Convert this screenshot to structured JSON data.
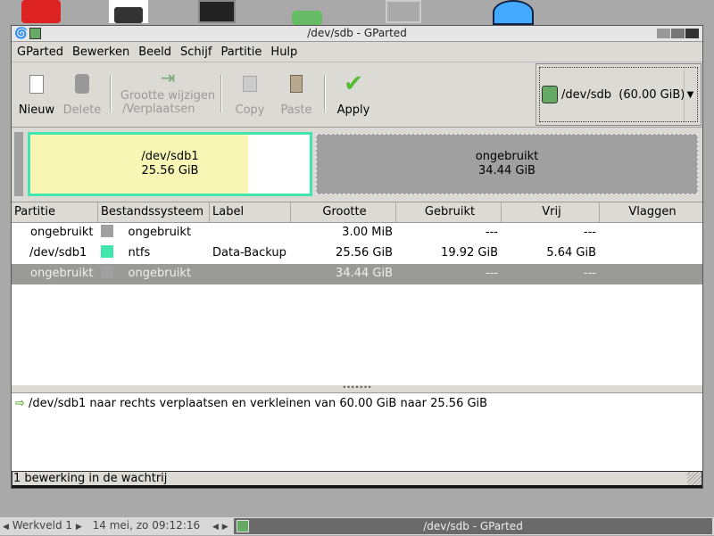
{
  "window": {
    "title": "/dev/sdb - GParted"
  },
  "menu": [
    "GParted",
    "Bewerken",
    "Beeld",
    "Schijf",
    "Partitie",
    "Hulp"
  ],
  "toolbar": {
    "new": "Nieuw",
    "delete": "Delete",
    "resize1": "Grootte wijzigen",
    "resize2": "/Verplaatsen",
    "copy": "Copy",
    "paste": "Paste",
    "apply": "Apply"
  },
  "device": {
    "name": "/dev/sdb",
    "size": "(60.00 GiB)"
  },
  "map": {
    "p1": {
      "name": "/dev/sdb1",
      "size": "25.56 GiB",
      "used_fraction": 0.78
    },
    "p2": {
      "name": "ongebruikt",
      "size": "34.44 GiB"
    }
  },
  "table": {
    "headers": [
      "Partitie",
      "Bestandssysteem",
      "Label",
      "Grootte",
      "Gebruikt",
      "Vrij",
      "Vlaggen"
    ],
    "rows": [
      {
        "partition": "ongebruikt",
        "fs": "ongebruikt",
        "color": "#a0a0a0",
        "label": "",
        "size": "3.00 MiB",
        "used": "---",
        "free": "---",
        "flags": ""
      },
      {
        "partition": "/dev/sdb1",
        "fs": "ntfs",
        "color": "#42e5ac",
        "label": "Data-Backup",
        "size": "25.56 GiB",
        "used": "19.92 GiB",
        "free": "5.64 GiB",
        "flags": ""
      },
      {
        "partition": "ongebruikt",
        "fs": "ongebruikt",
        "color": "#a0a0a0",
        "label": "",
        "size": "34.44 GiB",
        "used": "---",
        "free": "---",
        "flags": ""
      }
    ]
  },
  "log": {
    "op": "/dev/sdb1 naar rechts verplaatsen en verkleinen van 60.00 GiB naar 25.56 GiB"
  },
  "status": "1 bewerking in de wachtrij",
  "taskbar": {
    "workspace": "Werkveld 1",
    "clock": "14 mei, zo 09:12:16",
    "app": "/dev/sdb - GParted"
  }
}
